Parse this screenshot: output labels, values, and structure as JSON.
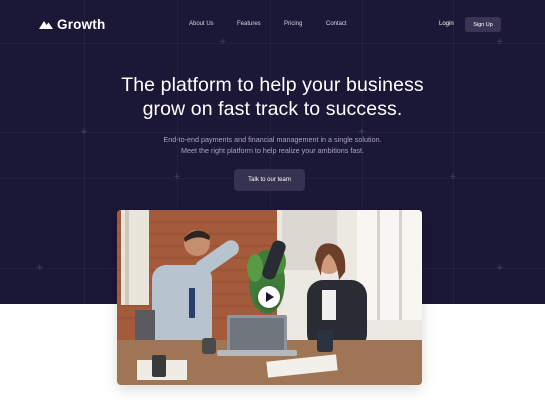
{
  "nav": {
    "logo_text": "Growth",
    "logo_icon": "mountain-icon",
    "menu": [
      {
        "label": "About Us"
      },
      {
        "label": "Features"
      },
      {
        "label": "Pricing"
      },
      {
        "label": "Contact"
      }
    ],
    "login_label": "Login",
    "signup_label": "Sign Up"
  },
  "hero": {
    "headline_line1": "The platform to help your business",
    "headline_line2": "grow on fast track to success.",
    "sub_line1": "End-to-end payments and financial management in a single solution.",
    "sub_line2": "Meet the right platform to help realize your ambitions fast.",
    "cta_label": "Talk to our team"
  },
  "media": {
    "play_icon": "play-icon"
  },
  "colors": {
    "hero_bg": "#1b1736",
    "button_bg": "#363252",
    "text_light": "#ffffff",
    "text_muted": "#a8a5bf"
  }
}
